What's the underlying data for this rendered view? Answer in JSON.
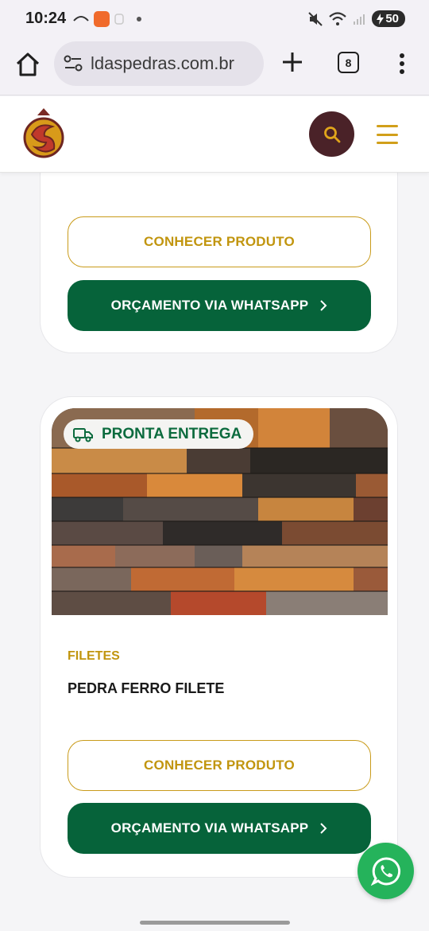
{
  "status_bar": {
    "time": "10:24",
    "battery": "50",
    "icons": [
      "missed-call-icon",
      "app-notification-icon",
      "wearable-icon",
      "dot-icon",
      "mute-icon",
      "wifi-icon",
      "signal-icon",
      "battery-icon"
    ]
  },
  "browser": {
    "url": "ldaspedras.com.br",
    "tab_count": "8",
    "icons": [
      "home-icon",
      "site-settings-icon",
      "new-tab-icon",
      "tabs-icon",
      "more-icon"
    ]
  },
  "header": {
    "icons": [
      "logo",
      "search-icon",
      "menu-icon"
    ]
  },
  "products": [
    {
      "view_label": "CONHECER PRODUTO",
      "quote_label": "ORÇAMENTO VIA WHATSAPP"
    },
    {
      "badge": "PRONTA ENTREGA",
      "category": "FILETES",
      "name": "PEDRA FERRO FILETE",
      "view_label": "CONHECER PRODUTO",
      "quote_label": "ORÇAMENTO VIA WHATSAPP"
    }
  ],
  "floating": {
    "icon": "whatsapp-icon"
  },
  "colors": {
    "accent_gold": "#c1950e",
    "whatsapp_green": "#06633a",
    "search_button": "#4a2228",
    "float_green": "#25b35b"
  }
}
